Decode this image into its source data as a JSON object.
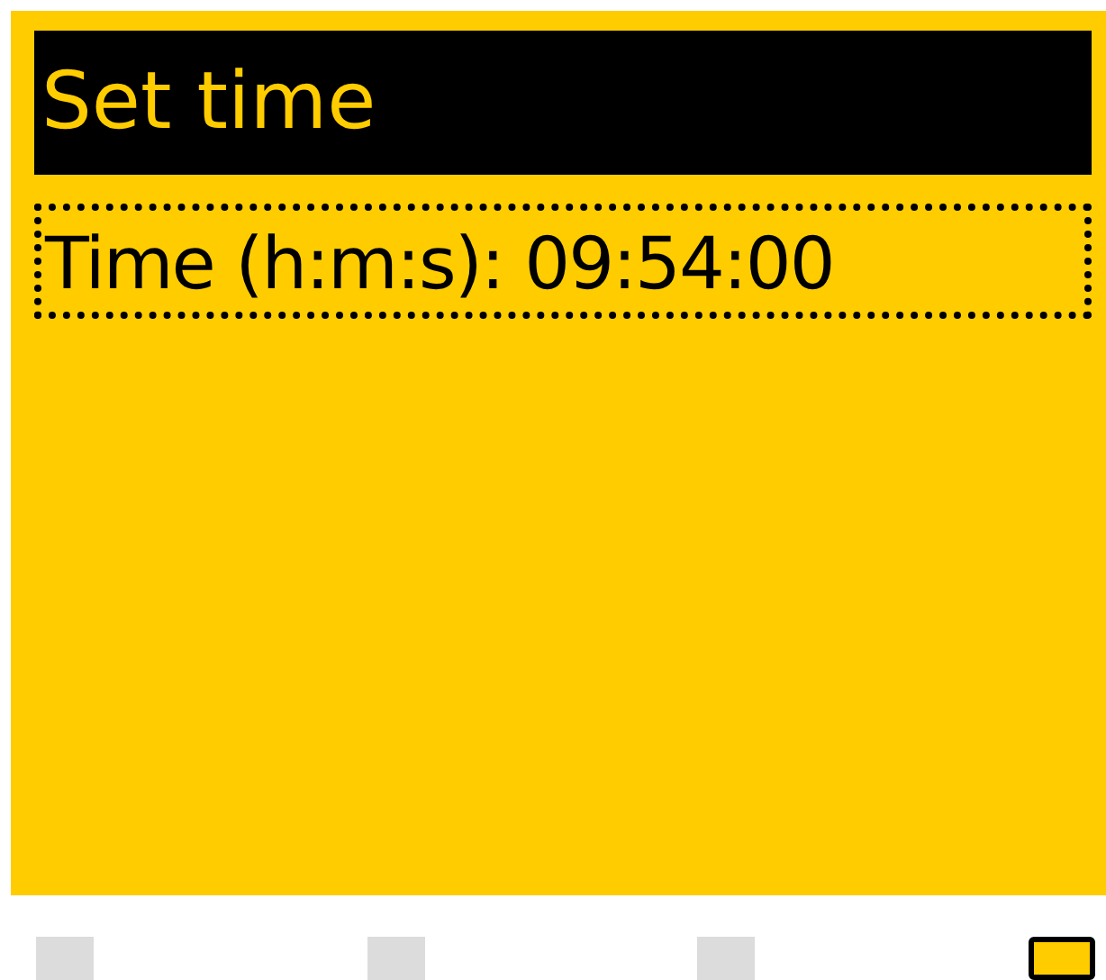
{
  "title": "Set time",
  "field": {
    "label": "Time (h:m:s): 09:54:00",
    "focused": true
  },
  "page_indicators": [
    {
      "selected": false
    },
    {
      "selected": false
    },
    {
      "selected": false
    },
    {
      "selected": true
    }
  ]
}
